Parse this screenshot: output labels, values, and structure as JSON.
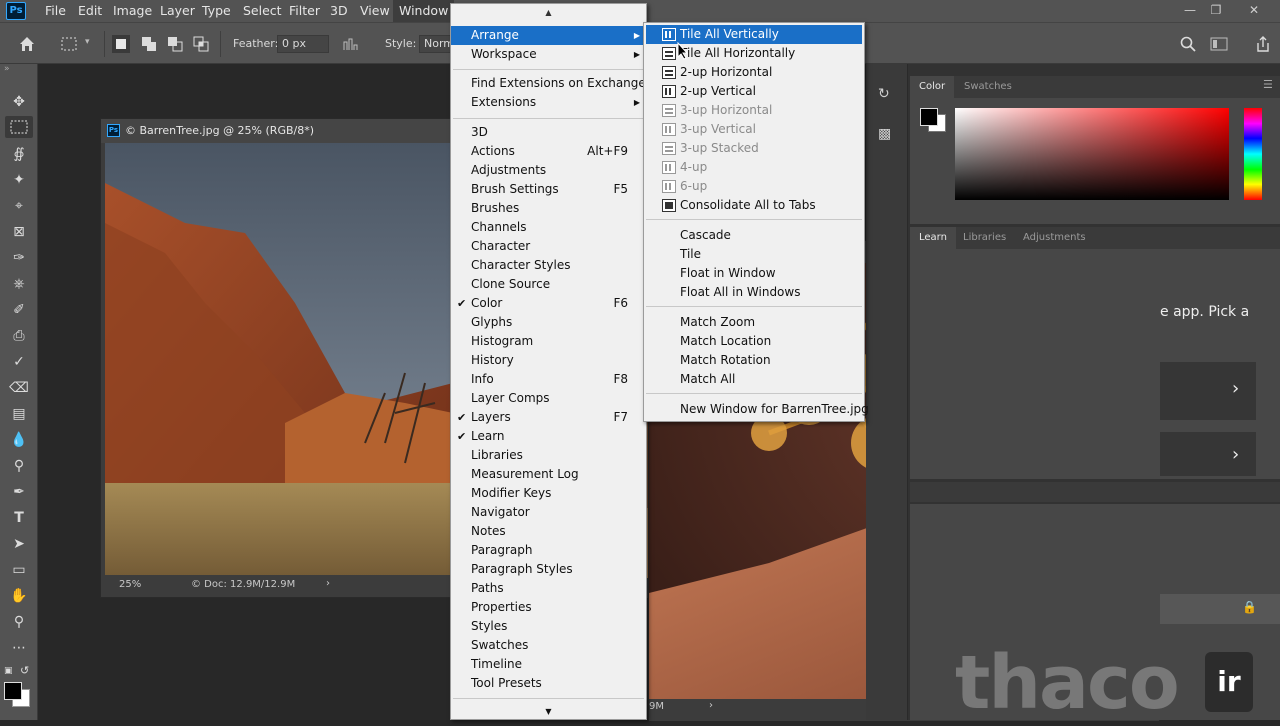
{
  "app": {
    "logo": "Ps",
    "menus": [
      "File",
      "Edit",
      "Image",
      "Layer",
      "Type",
      "Select",
      "Filter",
      "3D",
      "View",
      "Window"
    ],
    "active_menu": "Window"
  },
  "options_bar": {
    "feather_label": "Feather:",
    "feather_value": "0 px",
    "style_label": "Style:",
    "style_value": "Norma"
  },
  "document1": {
    "title": "© BarrenTree.jpg @ 25% (RGB/8*)",
    "zoom": "25%",
    "doc_info": "© Doc: 12.9M/12.9M",
    "status_arrow": "›"
  },
  "document3": {
    "status_doc": "9M",
    "status_arrow": "›"
  },
  "panels": {
    "color_tab": "Color",
    "swatches_tab": "Swatches",
    "learn_tab": "Learn",
    "libraries_tab": "Libraries",
    "adjustments_tab": "Adjustments",
    "learn_text": "e app. Pick a"
  },
  "window_menu": {
    "items": [
      {
        "label": "Arrange",
        "submenu": true,
        "highlight": true
      },
      {
        "label": "Workspace",
        "submenu": true
      },
      {
        "label": "Find Extensions on Exchange..."
      },
      {
        "label": "Extensions",
        "submenu": true
      },
      {
        "label": "3D"
      },
      {
        "label": "Actions",
        "shortcut": "Alt+F9"
      },
      {
        "label": "Adjustments"
      },
      {
        "label": "Brush Settings",
        "shortcut": "F5"
      },
      {
        "label": "Brushes"
      },
      {
        "label": "Channels"
      },
      {
        "label": "Character"
      },
      {
        "label": "Character Styles"
      },
      {
        "label": "Clone Source"
      },
      {
        "label": "Color",
        "shortcut": "F6",
        "checked": true
      },
      {
        "label": "Glyphs"
      },
      {
        "label": "Histogram"
      },
      {
        "label": "History"
      },
      {
        "label": "Info",
        "shortcut": "F8"
      },
      {
        "label": "Layer Comps"
      },
      {
        "label": "Layers",
        "shortcut": "F7",
        "checked": true
      },
      {
        "label": "Learn",
        "checked": true
      },
      {
        "label": "Libraries"
      },
      {
        "label": "Measurement Log"
      },
      {
        "label": "Modifier Keys"
      },
      {
        "label": "Navigator"
      },
      {
        "label": "Notes"
      },
      {
        "label": "Paragraph"
      },
      {
        "label": "Paragraph Styles"
      },
      {
        "label": "Paths"
      },
      {
        "label": "Properties"
      },
      {
        "label": "Styles"
      },
      {
        "label": "Swatches"
      },
      {
        "label": "Timeline"
      },
      {
        "label": "Tool Presets"
      }
    ]
  },
  "arrange_menu": {
    "items": [
      {
        "label": "Tile All Vertically",
        "icon": "tile-vertical-icon",
        "highlight": true
      },
      {
        "label": "Tile All Horizontally",
        "icon": "tile-horizontal-icon"
      },
      {
        "label": "2-up Horizontal",
        "icon": "two-up-horizontal-icon"
      },
      {
        "label": "2-up Vertical",
        "icon": "two-up-vertical-icon"
      },
      {
        "label": "3-up Horizontal",
        "icon": "three-up-horizontal-icon",
        "disabled": true
      },
      {
        "label": "3-up Vertical",
        "icon": "three-up-vertical-icon",
        "disabled": true
      },
      {
        "label": "3-up Stacked",
        "icon": "three-up-stacked-icon",
        "disabled": true
      },
      {
        "label": "4-up",
        "icon": "four-up-icon",
        "disabled": true
      },
      {
        "label": "6-up",
        "icon": "six-up-icon",
        "disabled": true
      },
      {
        "label": "Consolidate All to Tabs",
        "icon": "consolidate-icon"
      },
      {
        "label": "Cascade"
      },
      {
        "label": "Tile"
      },
      {
        "label": "Float in Window"
      },
      {
        "label": "Float All in Windows"
      },
      {
        "label": "Match Zoom"
      },
      {
        "label": "Match Location"
      },
      {
        "label": "Match Rotation"
      },
      {
        "label": "Match All"
      },
      {
        "label": "New Window for BarrenTree.jpg"
      }
    ]
  },
  "watermark": {
    "text": "thaco",
    "badge": "ir"
  },
  "colors": {
    "highlight": "#1a6fc7",
    "ui_dark": "#535353",
    "menu_bg": "#f0f0f0"
  }
}
